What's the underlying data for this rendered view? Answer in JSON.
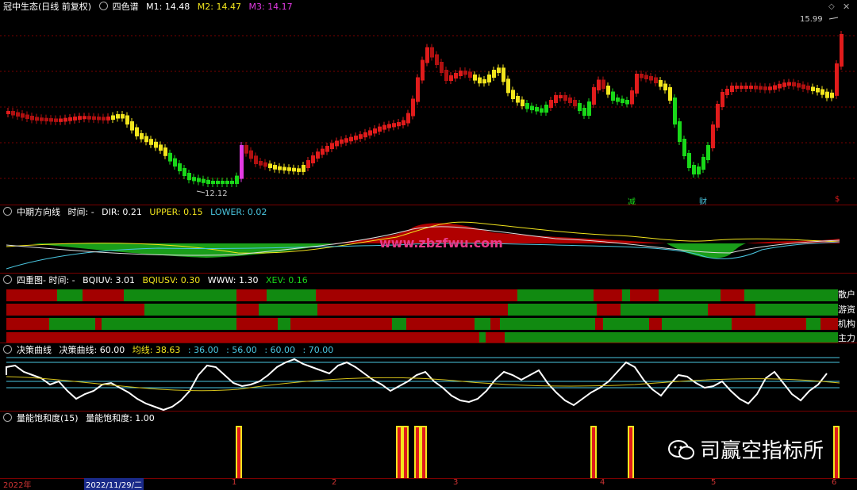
{
  "main": {
    "title": "冠中生态(日线 前复权)",
    "indicator": "四色谱",
    "m1": "M1: 14.48",
    "m2": "M2: 14.47",
    "m3": "M3: 14.17",
    "high_label": "15.99",
    "low_label": "12.12",
    "markers": [
      "减",
      "财",
      "$"
    ]
  },
  "dir_panel": {
    "title": "中期方向线",
    "time": "时间: -",
    "dir": "DIR: 0.21",
    "upper": "UPPER: 0.15",
    "lower": "LOWER: 0.02",
    "watermark": "www.zbzfwu.com"
  },
  "four_panel": {
    "title": "四重图- 时间: -",
    "bqiuv": "BQIUV: 3.01",
    "bqiusv": "BQIUSV: 0.30",
    "www": "WWW: 1.30",
    "xev": "XEV: 0.16",
    "rows": [
      "散户",
      "游资",
      "机构",
      "主力"
    ]
  },
  "decision_panel": {
    "title": "决策曲线",
    "line": "决策曲线: 60.00",
    "avg": "均线: 38.63",
    "l36": ": 36.00",
    "l56": ": 56.00",
    "l60": ": 60.00",
    "l70": ": 70.00"
  },
  "energy_panel": {
    "title": "量能饱和度(15)",
    "value": "量能饱和度: 1.00"
  },
  "axis": {
    "year": "2022年",
    "cursor_date": "2022/11/29/二",
    "months": [
      "1",
      "2",
      "3",
      "4",
      "5",
      "6"
    ]
  },
  "logo": "司赢空指标所",
  "colors": {
    "up": "#e01b1b",
    "down": "#19d819",
    "weak": "#f2e51d",
    "magenta": "#e33ae3",
    "grid": "#7a0000",
    "cyan": "#4ac6e0"
  }
}
